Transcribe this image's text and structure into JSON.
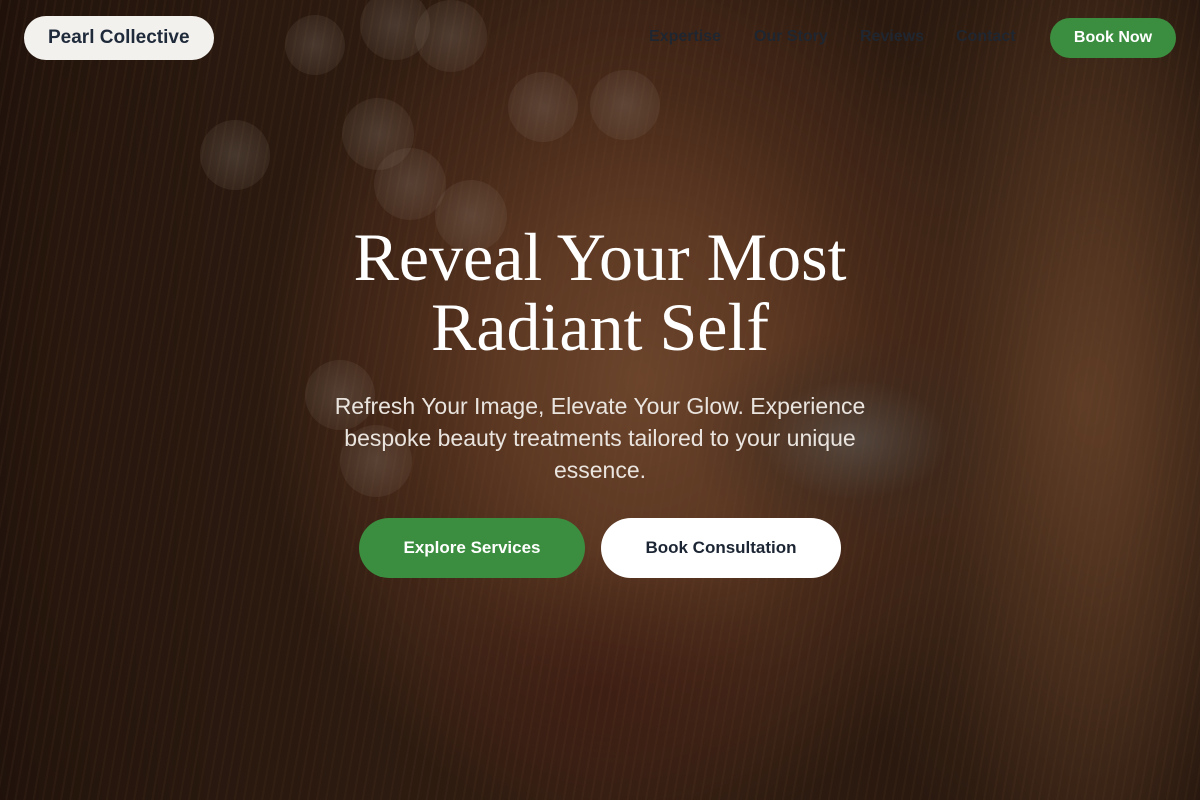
{
  "brand": {
    "name": "Pearl Collective"
  },
  "nav": {
    "links": [
      "Expertise",
      "Our Story",
      "Reviews",
      "Contact"
    ],
    "cta_label": "Book Now"
  },
  "hero": {
    "headline_line1": "Reveal Your Most",
    "headline_line2": "Radiant Self",
    "subtitle": "Refresh Your Image, Elevate Your Glow. Experience bespoke beauty treatments tailored to your unique essence.",
    "primary_button": "Explore Services",
    "secondary_button": "Book Consultation"
  },
  "colors": {
    "accent_green": "#3b8e3f",
    "logo_pill_bg": "#f3f1ee",
    "nav_text": "#1f2630",
    "headline_text": "#ffffff"
  }
}
